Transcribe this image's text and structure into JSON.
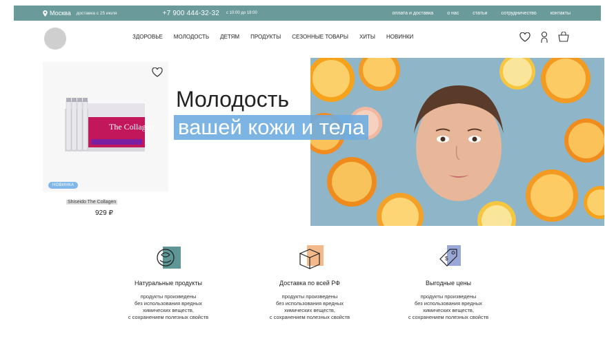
{
  "topbar": {
    "city": "Москва",
    "delivery": "доставка с 25 июля",
    "phone": "+7 900 444-32-32",
    "hours": "с 10:00 до 18:00",
    "links": [
      "оплата и доставка",
      "о нас",
      "статьи",
      "сотрудничество",
      "контакты"
    ]
  },
  "nav": {
    "items": [
      "ЗДОРОВЬЕ",
      "МОЛОДОСТЬ",
      "ДЕТЯМ",
      "ПРОДУКТЫ",
      "СЕЗОННЫЕ ТОВАРЫ",
      "ХИТЫ",
      "НОВИНКИ"
    ]
  },
  "product": {
    "image_text": "The Collagen",
    "badge": "НОВИНКА",
    "name": "Shiseido The Collagen",
    "price": "929 ₽"
  },
  "hero": {
    "title": "Молодость",
    "subtitle": "вашей кожи и тела"
  },
  "features": [
    {
      "title": "Натуральные продукты",
      "lines": [
        "продукты произведены",
        "без использования вредных",
        "химических веществ,",
        "с сохранением полезных свойств"
      ]
    },
    {
      "title": "Доставка по всей РФ",
      "lines": [
        "продукты произведены",
        "без использования вредных",
        "химических веществ,",
        "с сохранением полезных свойств"
      ]
    },
    {
      "title": "Выгодные цены",
      "lines": [
        "продукты произведены",
        "без использования вредных",
        "химических веществ,",
        "с сохранением полезных свойств"
      ]
    }
  ],
  "colors": {
    "topbar": "#6b9a9a",
    "accent": "#7fb8e8"
  }
}
